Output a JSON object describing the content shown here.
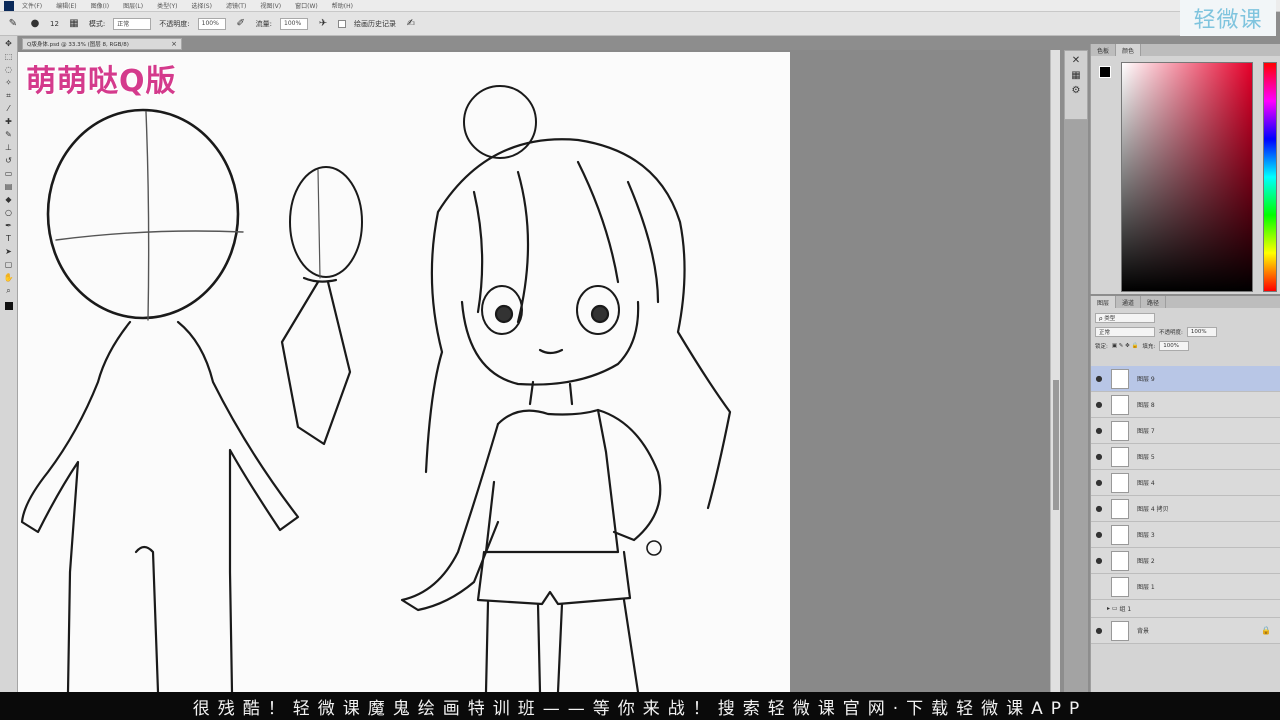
{
  "menubar": {
    "items": [
      "文件(F)",
      "编辑(E)",
      "图像(I)",
      "图层(L)",
      "类型(Y)",
      "选择(S)",
      "滤镜(T)",
      "视图(V)",
      "窗口(W)",
      "帮助(H)"
    ]
  },
  "options": {
    "size": "12",
    "mode_label": "模式:",
    "mode_value": "正常",
    "opacity_label": "不透明度:",
    "opacity_value": "100%",
    "flow_label": "流量:",
    "flow_value": "100%",
    "history_label": "绘画历史记录"
  },
  "watermark": {
    "text": "轻微课"
  },
  "document": {
    "tab_title": "Q版身体.psd @ 33.3% (图层 8, RGB/8)"
  },
  "canvas": {
    "brand_text": "萌萌哒Q版"
  },
  "panels": {
    "color_tabs": [
      "色板",
      "颜色"
    ],
    "layers_tabs": [
      "图层",
      "通道",
      "路径"
    ],
    "kind_label": "ρ 类型",
    "blend_mode": "正常",
    "opacity_label": "不透明度:",
    "opacity_value": "100%",
    "lock_label": "锁定:",
    "fill_label": "填充:",
    "fill_value": "100%"
  },
  "layers": [
    {
      "name": "图层 9",
      "selected": true
    },
    {
      "name": "图层 8"
    },
    {
      "name": "图层 7"
    },
    {
      "name": "图层 5"
    },
    {
      "name": "图层 4"
    },
    {
      "name": "图层 4 拷贝"
    },
    {
      "name": "图层 3"
    },
    {
      "name": "图层 2"
    },
    {
      "name": "图层 1"
    },
    {
      "name": "组 1",
      "group": true
    },
    {
      "name": "背景",
      "locked": true
    }
  ],
  "subtitle": {
    "text": "很残酷！轻微课魔鬼绘画特训班——等你来战！搜索轻微课官网·下载轻微课APP"
  }
}
